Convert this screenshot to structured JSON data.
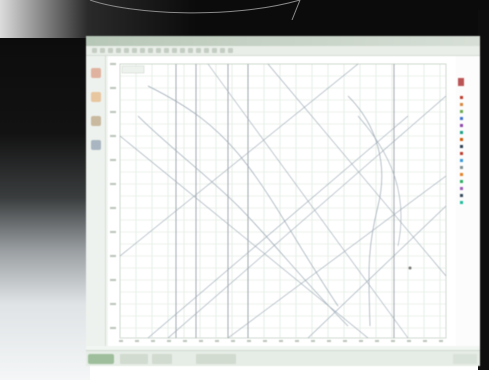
{
  "window": {
    "title": "",
    "controls": ""
  },
  "chart_tab": {
    "label": ""
  },
  "colors": {
    "grid": "#d9e6d9",
    "curve": "#9aa7b3",
    "accent_orange": "#d9843a",
    "accent_red": "#c0392b",
    "accent_blue": "#3b6fd1",
    "taskbar_start": "#9fbf9c"
  },
  "icons": {
    "sidebar": [
      "warning-icon",
      "flame-icon",
      "tool-icon",
      "chart-icon"
    ],
    "legend": [
      "legend-marker-icon"
    ]
  }
}
